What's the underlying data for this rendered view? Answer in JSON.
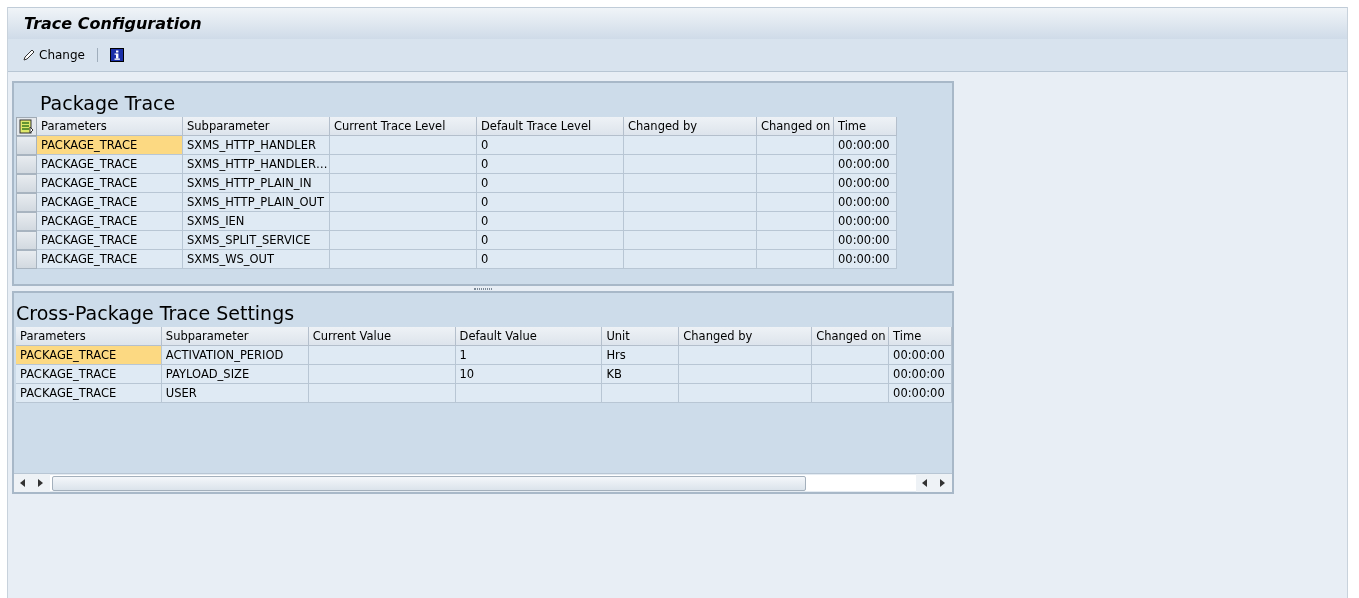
{
  "window": {
    "title": "Trace Configuration"
  },
  "toolbar": [
    {
      "kind": "pencil",
      "label": "Change"
    },
    {
      "kind": "info"
    }
  ],
  "panels": [
    {
      "title": "Package Trace",
      "row_selectors": true,
      "columns": [
        "Parameters",
        "Subparameter",
        "Current Trace Level",
        "Default Trace Level",
        "Changed by",
        "Changed on",
        "Time"
      ],
      "rows": [
        {
          "current": true,
          "cells": [
            "PACKAGE_TRACE",
            "SXMS_HTTP_HANDLER",
            "",
            "0",
            "",
            "",
            "00:00:00"
          ]
        },
        {
          "current": false,
          "cells": [
            "PACKAGE_TRACE",
            "SXMS_HTTP_HANDLER…",
            "",
            "0",
            "",
            "",
            "00:00:00"
          ]
        },
        {
          "current": false,
          "cells": [
            "PACKAGE_TRACE",
            "SXMS_HTTP_PLAIN_IN",
            "",
            "0",
            "",
            "",
            "00:00:00"
          ]
        },
        {
          "current": false,
          "cells": [
            "PACKAGE_TRACE",
            "SXMS_HTTP_PLAIN_OUT",
            "",
            "0",
            "",
            "",
            "00:00:00"
          ]
        },
        {
          "current": false,
          "cells": [
            "PACKAGE_TRACE",
            "SXMS_IEN",
            "",
            "0",
            "",
            "",
            "00:00:00"
          ]
        },
        {
          "current": false,
          "cells": [
            "PACKAGE_TRACE",
            "SXMS_SPLIT_SERVICE",
            "",
            "0",
            "",
            "",
            "00:00:00"
          ]
        },
        {
          "current": false,
          "cells": [
            "PACKAGE_TRACE",
            "SXMS_WS_OUT",
            "",
            "0",
            "",
            "",
            "00:00:00"
          ]
        }
      ]
    },
    {
      "title": "Cross-Package Trace Settings",
      "row_selectors": false,
      "scrollbar": true,
      "columns": [
        "Parameters",
        "Subparameter",
        "Current Value",
        "Default Value",
        "Unit",
        "Changed by",
        "Changed on",
        "Time"
      ],
      "rows": [
        {
          "current": true,
          "cells": [
            "PACKAGE_TRACE",
            "ACTIVATION_PERIOD",
            "",
            "1",
            "Hrs",
            "",
            "",
            "00:00:00"
          ]
        },
        {
          "current": false,
          "cells": [
            "PACKAGE_TRACE",
            "PAYLOAD_SIZE",
            "",
            "10",
            "KB",
            "",
            "",
            "00:00:00"
          ]
        },
        {
          "current": false,
          "cells": [
            "PACKAGE_TRACE",
            "USER",
            "",
            "",
            "",
            "",
            "",
            "00:00:00"
          ]
        }
      ]
    }
  ]
}
